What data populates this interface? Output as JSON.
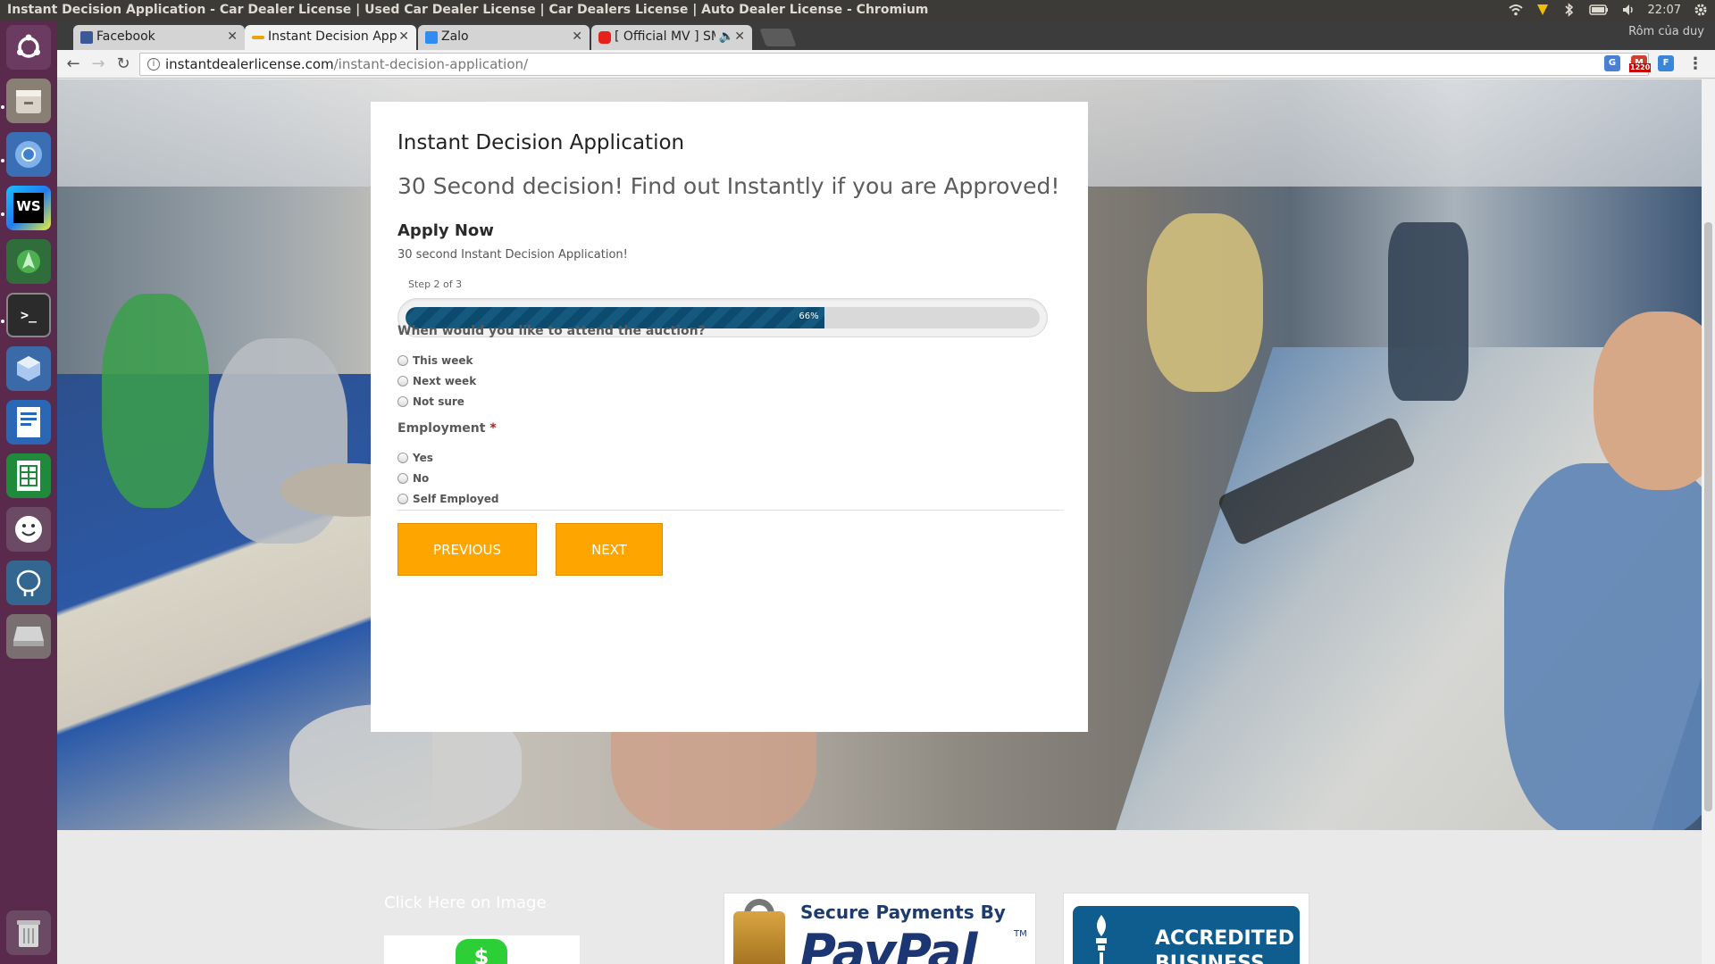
{
  "os": {
    "window_title": "Instant Decision Application - Car Dealer License | Used Car Dealer License | Car Dealers License | Auto Dealer License - Chromium",
    "clock": "22:07",
    "tray_icons": [
      "wifi-icon",
      "app-indicator-icon",
      "bluetooth-icon",
      "battery-icon",
      "volume-icon",
      "settings-icon"
    ]
  },
  "launcher": {
    "apps": [
      "ubuntu-logo-icon",
      "files-icon",
      "chromium-icon",
      "webstorm-icon",
      "android-studio-icon",
      "terminal-icon",
      "virtualbox-icon",
      "writer-icon",
      "calc-icon",
      "emoji-app-icon",
      "postgres-icon",
      "drive-icon",
      "trash-icon"
    ]
  },
  "tabs": [
    {
      "label": "Facebook",
      "favicon": "facebook-icon",
      "color": "#3b5998"
    },
    {
      "label": "Instant Decision App",
      "favicon": "site-icon",
      "color": "#e8a400"
    },
    {
      "label": "Zalo",
      "favicon": "zalo-icon",
      "color": "#2f8cf5"
    },
    {
      "label": "[ Official MV ] SMO",
      "favicon": "youtube-icon",
      "color": "#e62117"
    }
  ],
  "profile": "Rôm của duy",
  "address": {
    "domain": "instantdealerlicense.com",
    "path": "/instant-decision-application/"
  },
  "extensions": [
    {
      "name": "translate-icon",
      "color": "#4a7fd6"
    },
    {
      "name": "gmail-icon",
      "color": "#d23f31",
      "badge": "1220"
    },
    {
      "name": "extension-f-icon",
      "color": "#3a86d6"
    }
  ],
  "form": {
    "title": "Instant Decision Application",
    "subtitle": "30 Second decision! Find out Instantly if you are Approved!",
    "section_title": "Apply Now",
    "section_desc": "30 second Instant Decision Application!",
    "step_label": "Step 2 of 3",
    "progress": 0.66,
    "progress_text": "66%",
    "q1": {
      "label": "When would you like to attend the auction?",
      "options": [
        "This week",
        "Next week",
        "Not sure"
      ]
    },
    "q2": {
      "label": "Employment",
      "required_mark": "*",
      "options": [
        "Yes",
        "No",
        "Self Employed"
      ]
    },
    "prev_label": "PREVIOUS",
    "next_label": "NEXT",
    "accent": "#ffa500",
    "progress_color": "#0c4a6e"
  },
  "footer": {
    "click_image": "Click Here on Image",
    "cash_symbol": "$",
    "paypal_secure": "Secure Payments By",
    "paypal_logo": "PayPal",
    "paypal_tm": "TM",
    "bbb_line1": "ACCREDITED",
    "bbb_line2": "BUSINESS"
  }
}
